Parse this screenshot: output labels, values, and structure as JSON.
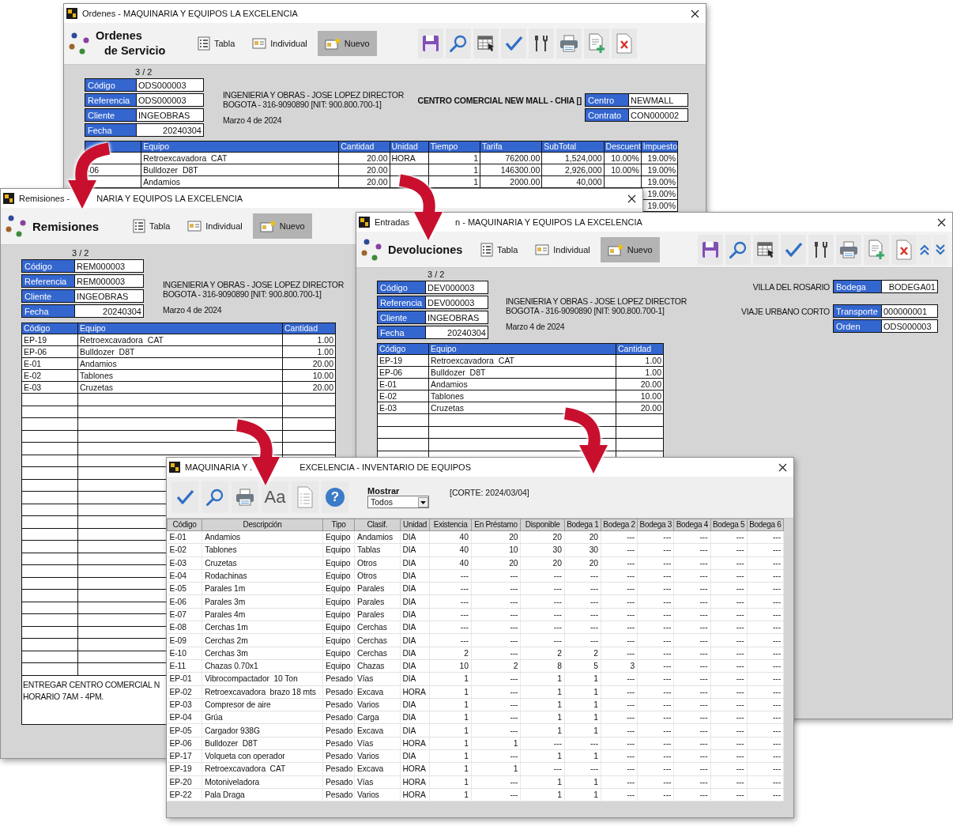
{
  "ordenes_window": {
    "title": "Ordenes - MAQUINARIA Y EQUIPOS LA EXCELENCIA",
    "heading": [
      "Ordenes",
      "de Servicio"
    ],
    "nav": [
      {
        "label": "Tabla",
        "selected": false
      },
      {
        "label": "Individual",
        "selected": false
      },
      {
        "label": "Nuevo",
        "selected": true
      }
    ],
    "record": "3 / 2",
    "fields": [
      {
        "label": "Código",
        "value": "ODS000003"
      },
      {
        "label": "Referencia",
        "value": "ODS000003"
      },
      {
        "label": "Cliente",
        "value": "INGEOBRAS"
      },
      {
        "label": "Fecha",
        "value": "20240304"
      }
    ],
    "client": [
      "INGENIERIA Y OBRAS - JOSE LOPEZ DIRECTOR",
      "BOGOTA - 316-9090890 [NIT: 900.800.700-1]"
    ],
    "date": "Marzo 4 de 2024",
    "location": "CENTRO COMERCIAL NEW MALL - CHIA []",
    "side_fields": [
      {
        "label": "Centro",
        "value": "NEWMALL"
      },
      {
        "label": "Contrato",
        "value": "CON000002"
      }
    ],
    "table": {
      "columns": [
        "Equipo",
        "Cantidad",
        "Unidad",
        "Tiempo",
        "Tarifa",
        "SubTotal",
        "Descuent",
        "Impuesto"
      ],
      "rows": [
        {
          "equipo": "Retroexcavadora  CAT",
          "cantidad": "20.00",
          "unidad": "HORA",
          "tiempo": "1",
          "tarifa": "76200.00",
          "subtotal": "1,524,000",
          "descuento": "10.00%",
          "impuesto": "19.00%"
        },
        {
          "code": "-06",
          "equipo": "Bulldozer  D8T",
          "cantidad": "20.00",
          "tiempo": "1",
          "tarifa": "146300.00",
          "subtotal": "2,926,000",
          "descuento": "10.00%",
          "impuesto": "19.00%"
        },
        {
          "equipo": "Andamios",
          "cantidad": "20.00",
          "tiempo": "1",
          "tarifa": "2000.00",
          "subtotal": "40,000",
          "impuesto": "19.00%"
        },
        {
          "impuesto": "19.00%"
        },
        {
          "impuesto": "19.00%"
        }
      ]
    }
  },
  "remisiones_window": {
    "title_parts": [
      "Remisiones -",
      "NARIA Y EQUIPOS LA EXCELENCIA"
    ],
    "heading": "Remisiones",
    "nav": [
      {
        "label": "Tabla",
        "selected": false
      },
      {
        "label": "Individual",
        "selected": false
      },
      {
        "label": "Nuevo",
        "selected": true
      }
    ],
    "record": "3 / 2",
    "fields": [
      {
        "label": "Código",
        "value": "REM000003"
      },
      {
        "label": "Referencia",
        "value": "REM000003"
      },
      {
        "label": "Cliente",
        "value": "INGEOBRAS"
      },
      {
        "label": "Fecha",
        "value": "20240304"
      }
    ],
    "client": [
      "INGENIERIA Y OBRAS - JOSE LOPEZ DIRECTOR",
      "BOGOTA - 316-9090890 [NIT: 900.800.700-1]"
    ],
    "date": "Marzo 4 de 2024",
    "table": {
      "columns": [
        "Código",
        "Equipo",
        "Cantidad"
      ],
      "rows": [
        [
          "EP-19",
          "Retroexcavadora  CAT",
          "1.00"
        ],
        [
          "EP-06",
          "Bulldozer  D8T",
          "1.00"
        ],
        [
          "E-01",
          "Andamios",
          "20.00"
        ],
        [
          "E-02",
          "Tablones",
          "10.00"
        ],
        [
          "E-03",
          "Cruzetas",
          "20.00"
        ]
      ]
    },
    "note": [
      "ENTREGAR CENTRO COMERCIAL N",
      "HORARIO 7AM - 4PM."
    ]
  },
  "devoluciones_window": {
    "title_parts": [
      "Entradas",
      "n - MAQUINARIA Y EQUIPOS LA EXCELENCIA"
    ],
    "heading": "Devoluciones",
    "nav": [
      {
        "label": "Tabla",
        "selected": false
      },
      {
        "label": "Individual",
        "selected": false
      },
      {
        "label": "Nuevo",
        "selected": true
      }
    ],
    "record": "3 / 2",
    "fields": [
      {
        "label": "Código",
        "value": "DEV000003"
      },
      {
        "label": "Referencia",
        "value": "DEV000003"
      },
      {
        "label": "Cliente",
        "value": "INGEOBRAS"
      },
      {
        "label": "Fecha",
        "value": "20240304"
      }
    ],
    "client": [
      "INGENIERIA Y OBRAS - JOSE LOPEZ DIRECTOR",
      "BOGOTA - 316-9090890 [NIT: 900.800.700-1]"
    ],
    "date": "Marzo 4 de 2024",
    "warehouse_place": "VILLA DEL ROSARIO",
    "warehouse_field": {
      "label": "Bodega",
      "value": "BODEGA01"
    },
    "transport_place": "VIAJE URBANO CORTO",
    "side_fields": [
      {
        "label": "Transporte",
        "value": "000000001"
      },
      {
        "label": "Orden",
        "value": "ODS000003"
      }
    ],
    "table": {
      "columns": [
        "Código",
        "Equipo",
        "Cantidad"
      ],
      "rows": [
        [
          "EP-19",
          "Retroexcavadora  CAT",
          "1.00"
        ],
        [
          "EP-06",
          "Bulldozer  D8T",
          "1.00"
        ],
        [
          "E-01",
          "Andamios",
          "20.00"
        ],
        [
          "E-02",
          "Tablones",
          "10.00"
        ],
        [
          "E-03",
          "Cruzetas",
          "20.00"
        ]
      ]
    }
  },
  "inventario_window": {
    "title_parts": [
      "MAQUINARIA Y .",
      "EXCELENCIA - INVENTARIO DE EQUIPOS"
    ],
    "font_button": "Aa",
    "help_button": "?",
    "filter": {
      "label": "Mostrar",
      "value": "Todos"
    },
    "cutoff": "[CORTE: 2024/03/04]",
    "table": {
      "columns": [
        "Código",
        "Descripción",
        "Tipo",
        "Clasif.",
        "Unidad",
        "Existencia",
        "En Préstamo",
        "Disponible",
        "Bodega 1",
        "Bodega 2",
        "Bodega 3",
        "Bodega 4",
        "Bodega 5",
        "Bodega 6"
      ],
      "rows": [
        [
          "E-01",
          "Andamios",
          "Equipo",
          "Andamios",
          "DIA",
          "40",
          "20",
          "20",
          "20",
          "---",
          "---",
          "---",
          "---",
          "---"
        ],
        [
          "E-02",
          "Tablones",
          "Equipo",
          "Tablas",
          "DIA",
          "40",
          "10",
          "30",
          "30",
          "---",
          "---",
          "---",
          "---",
          "---"
        ],
        [
          "E-03",
          "Cruzetas",
          "Equipo",
          "Otros",
          "DIA",
          "40",
          "20",
          "20",
          "20",
          "---",
          "---",
          "---",
          "---",
          "---"
        ],
        [
          "E-04",
          "Rodachinas",
          "Equipo",
          "Otros",
          "DIA",
          "---",
          "---",
          "---",
          "---",
          "---",
          "---",
          "---",
          "---",
          "---"
        ],
        [
          "E-05",
          "Parales 1m",
          "Equipo",
          "Parales",
          "DIA",
          "---",
          "---",
          "---",
          "---",
          "---",
          "---",
          "---",
          "---",
          "---"
        ],
        [
          "E-06",
          "Parales 3m",
          "Equipo",
          "Parales",
          "DIA",
          "---",
          "---",
          "---",
          "---",
          "---",
          "---",
          "---",
          "---",
          "---"
        ],
        [
          "E-07",
          "Parales 4m",
          "Equipo",
          "Parales",
          "DIA",
          "---",
          "---",
          "---",
          "---",
          "---",
          "---",
          "---",
          "---",
          "---"
        ],
        [
          "E-08",
          "Cerchas 1m",
          "Equipo",
          "Cerchas",
          "DIA",
          "---",
          "---",
          "---",
          "---",
          "---",
          "---",
          "---",
          "---",
          "---"
        ],
        [
          "E-09",
          "Cerchas 2m",
          "Equipo",
          "Cerchas",
          "DIA",
          "---",
          "---",
          "---",
          "---",
          "---",
          "---",
          "---",
          "---",
          "---"
        ],
        [
          "E-10",
          "Cerchas 3m",
          "Equipo",
          "Cerchas",
          "DIA",
          "2",
          "---",
          "2",
          "2",
          "---",
          "---",
          "---",
          "---",
          "---"
        ],
        [
          "E-11",
          "Chazas 0.70x1",
          "Equipo",
          "Chazas",
          "DIA",
          "10",
          "2",
          "8",
          "5",
          "3",
          "---",
          "---",
          "---",
          "---"
        ],
        [
          "EP-01",
          "Vibrocompactador  10 Ton",
          "Pesado",
          "Vías",
          "DIA",
          "1",
          "---",
          "1",
          "1",
          "---",
          "---",
          "---",
          "---",
          "---"
        ],
        [
          "EP-02",
          "Retroexcavadora  brazo 18 mts",
          "Pesado",
          "Excava",
          "HORA",
          "1",
          "---",
          "1",
          "1",
          "---",
          "---",
          "---",
          "---",
          "---"
        ],
        [
          "EP-03",
          "Compresor de aire",
          "Pesado",
          "Varios",
          "DIA",
          "1",
          "---",
          "1",
          "1",
          "---",
          "---",
          "---",
          "---",
          "---"
        ],
        [
          "EP-04",
          "Grúa",
          "Pesado",
          "Carga",
          "DIA",
          "1",
          "---",
          "1",
          "1",
          "---",
          "---",
          "---",
          "---",
          "---"
        ],
        [
          "EP-05",
          "Cargador 938G",
          "Pesado",
          "Excava",
          "DIA",
          "1",
          "---",
          "1",
          "1",
          "---",
          "---",
          "---",
          "---",
          "---"
        ],
        [
          "EP-06",
          "Bulldozer  D8T",
          "Pesado",
          "Vías",
          "HORA",
          "1",
          "1",
          "---",
          "---",
          "---",
          "---",
          "---",
          "---",
          "---"
        ],
        [
          "EP-17",
          "Volqueta con operador",
          "Pesado",
          "Varios",
          "DIA",
          "1",
          "---",
          "1",
          "1",
          "---",
          "---",
          "---",
          "---",
          "---"
        ],
        [
          "EP-19",
          "Retroexcavadora  CAT",
          "Pesado",
          "Excava",
          "HORA",
          "1",
          "1",
          "---",
          "---",
          "---",
          "---",
          "---",
          "---",
          "---"
        ],
        [
          "EP-20",
          "Motoniveladora",
          "Pesado",
          "Vías",
          "HORA",
          "1",
          "---",
          "1",
          "1",
          "---",
          "---",
          "---",
          "---",
          "---"
        ],
        [
          "EP-22",
          "Pala Draga",
          "Pesado",
          "Varios",
          "HORA",
          "1",
          "---",
          "1",
          "1",
          "---",
          "---",
          "---",
          "---",
          "---"
        ]
      ]
    }
  }
}
